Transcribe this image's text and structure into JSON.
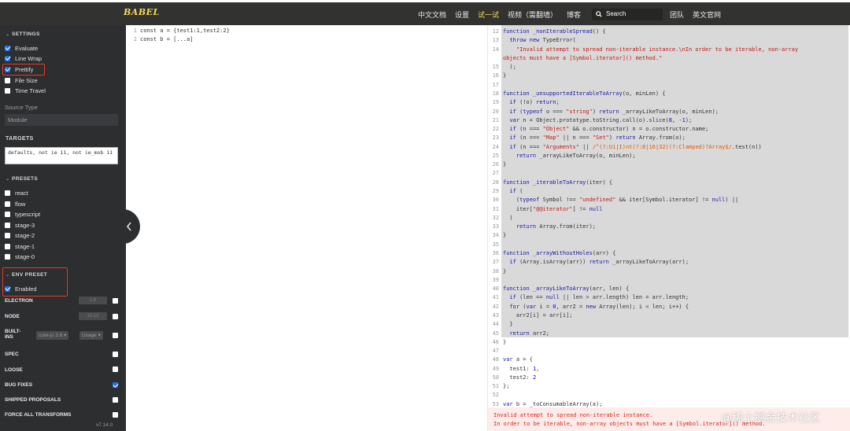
{
  "topbar": {
    "logo": "BABEL",
    "nav": [
      "中文文档",
      "设置",
      "试一试",
      "视频（需翻墙）",
      "博客",
      "团队",
      "英文官网"
    ],
    "search_placeholder": "Search"
  },
  "sidebar": {
    "settings_title": "SETTINGS",
    "settings": [
      {
        "label": "Evaluate",
        "checked": true
      },
      {
        "label": "Line Wrap",
        "checked": true
      },
      {
        "label": "Prettify",
        "checked": true
      },
      {
        "label": "File Size",
        "checked": false
      },
      {
        "label": "Time Travel",
        "checked": false
      }
    ],
    "source_type_label": "Source Type",
    "source_type_value": "Module",
    "targets_title": "TARGETS",
    "targets_value": "defaults, not ie 11, not ie_mob 11",
    "presets_title": "PRESETS",
    "presets": [
      {
        "label": "react",
        "checked": false
      },
      {
        "label": "flow",
        "checked": false
      },
      {
        "label": "typescript",
        "checked": false
      },
      {
        "label": "stage-3",
        "checked": false
      },
      {
        "label": "stage-2",
        "checked": false
      },
      {
        "label": "stage-1",
        "checked": false
      },
      {
        "label": "stage-0",
        "checked": false
      }
    ],
    "env_preset_title": "ENV PRESET",
    "env_enabled_label": "Enabled",
    "electron_label": "ELECTRON",
    "electron_value": "1.8",
    "node_label": "NODE",
    "node_value": "10.13",
    "builtins_label": "BUILT-INS",
    "corejs_value": "core-js 3.6 ▾",
    "usage_value": "Usage ▾",
    "spec_label": "SPEC",
    "loose_label": "LOOSE",
    "bugfixes_label": "BUG FIXES",
    "shipped_label": "SHIPPED PROPOSALS",
    "force_label": "FORCE ALL TRANSFORMS",
    "version": "v7.14.0"
  },
  "input_code": [
    {
      "n": "1",
      "text": "const a = {test1:1,test2:2}"
    },
    {
      "n": "2",
      "text": "const b = [...a]"
    }
  ],
  "error": {
    "line1": "Invalid attempt to spread non-iterable instance.",
    "line2": "In order to be iterable, non-array objects must have a [Symbol.iterator]() method."
  },
  "watermark": "@稀土掘金技术社区"
}
